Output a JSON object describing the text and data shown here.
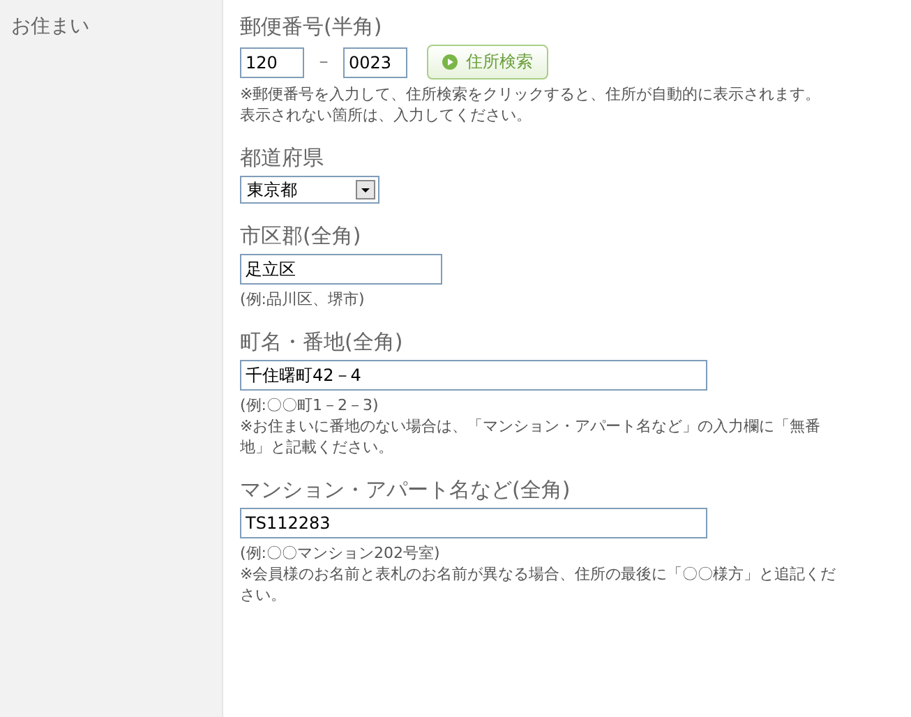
{
  "section_label": "お住まい",
  "fields": [
    {
      "kind": "postal",
      "label": "郵便番号(半角)",
      "parts": [
        "120",
        "0023"
      ],
      "separator": "－",
      "button": "住所検索",
      "notes": [
        "※郵便番号を入力して、住所検索をクリックすると、住所が自動的に表示されます。",
        "表示されない箇所は、入力してください。"
      ]
    },
    {
      "kind": "select",
      "label": "都道府県",
      "value": "東京都"
    },
    {
      "kind": "short_text",
      "label": "市区郡(全角)",
      "value": "足立区",
      "notes": [
        "(例:品川区、堺市)"
      ]
    },
    {
      "kind": "long_text",
      "label": "町名・番地(全角)",
      "value": "千住曙町42－4",
      "notes": [
        "(例:〇〇町1－2－3)",
        "※お住まいに番地のない場合は、「マンション・アパート名など」の入力欄に「無番地」と記載ください。"
      ]
    },
    {
      "kind": "long_text",
      "label": "マンション・アパート名など(全角)",
      "value": "TS112283",
      "notes": [
        "(例:〇〇マンション202号室)",
        "※会員様のお名前と表札のお名前が異なる場合、住所の最後に「〇〇様方」と追記ください。"
      ]
    }
  ]
}
